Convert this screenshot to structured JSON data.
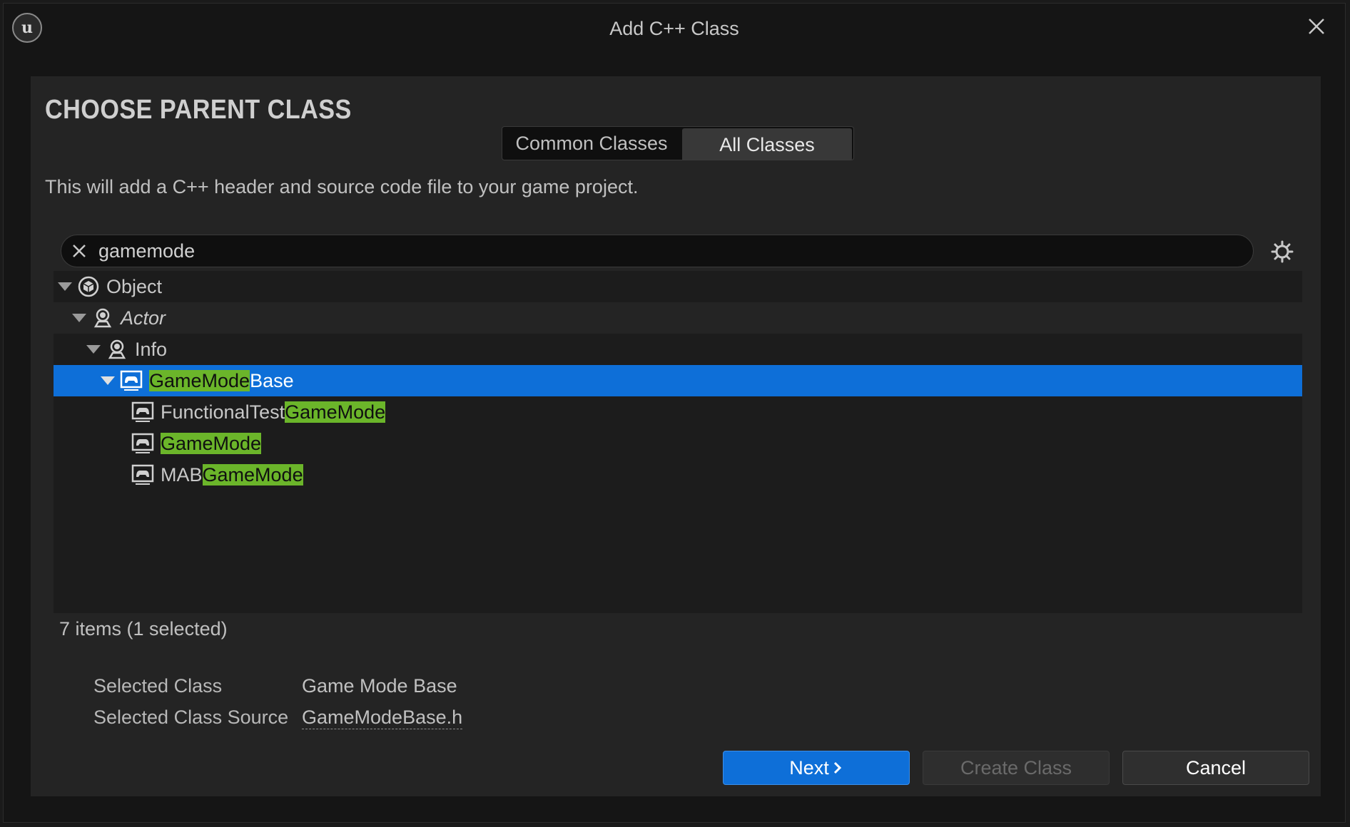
{
  "window": {
    "title": "Add C++ Class"
  },
  "header": {
    "heading": "CHOOSE PARENT CLASS",
    "description": "This will add a C++ header and source code file to your game project."
  },
  "tabs": [
    {
      "label": "Common Classes",
      "active": false
    },
    {
      "label": "All Classes",
      "active": true
    }
  ],
  "search": {
    "value": "gamemode"
  },
  "tree": {
    "rows": [
      {
        "pre": "",
        "match": "",
        "post": "Object",
        "depth": 0,
        "expanded": true,
        "icon": "object-icon"
      },
      {
        "pre": "",
        "match": "",
        "post": "Actor",
        "depth": 1,
        "expanded": true,
        "icon": "actor-icon"
      },
      {
        "pre": "",
        "match": "",
        "post": "Info",
        "depth": 2,
        "expanded": true,
        "icon": "actor-icon"
      },
      {
        "pre": "",
        "match": "GameMode",
        "post": "Base",
        "depth": 3,
        "expanded": true,
        "selected": true,
        "icon": "gamemode-icon"
      },
      {
        "pre": "FunctionalTest",
        "match": "GameMode",
        "post": "",
        "depth": 4,
        "icon": "gamemode-icon"
      },
      {
        "pre": "",
        "match": "GameMode",
        "post": "",
        "depth": 4,
        "icon": "gamemode-icon"
      },
      {
        "pre": "MAB",
        "match": "GameMode",
        "post": "",
        "depth": 4,
        "icon": "gamemode-icon"
      }
    ]
  },
  "status": {
    "count_text": "7 items (1 selected)"
  },
  "details": {
    "selected_class_label": "Selected Class",
    "selected_class_value": "Game Mode Base",
    "selected_source_label": "Selected Class Source",
    "selected_source_value": "GameModeBase.h"
  },
  "buttons": {
    "next": "Next",
    "create": "Create Class",
    "cancel": "Cancel"
  },
  "colors": {
    "accent": "#0e6fd8",
    "highlight": "#6bb52a"
  }
}
